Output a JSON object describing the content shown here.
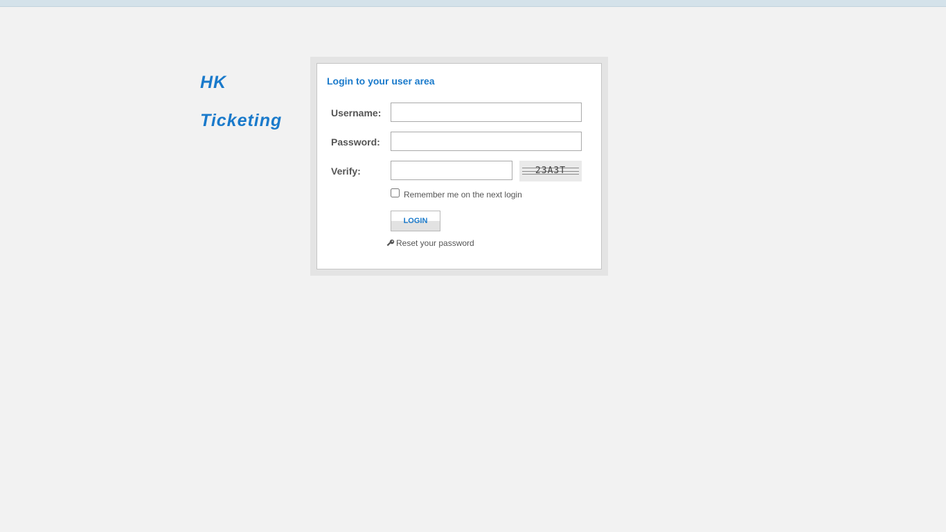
{
  "brand": {
    "line1": "HK",
    "line2": "Ticketing"
  },
  "login": {
    "title": "Login to your user area",
    "username_label": "Username:",
    "username_value": "",
    "password_label": "Password:",
    "password_value": "",
    "verify_label": "Verify:",
    "verify_value": "",
    "captcha_text": "23A3T",
    "remember_label": "Remember me on the next login",
    "remember_checked": false,
    "login_button": "LOGIN",
    "reset_link": "Reset your password",
    "reset_icon": "key-icon"
  },
  "colors": {
    "accent": "#1a7acb",
    "background": "#f2f2f2",
    "label": "#555555"
  }
}
